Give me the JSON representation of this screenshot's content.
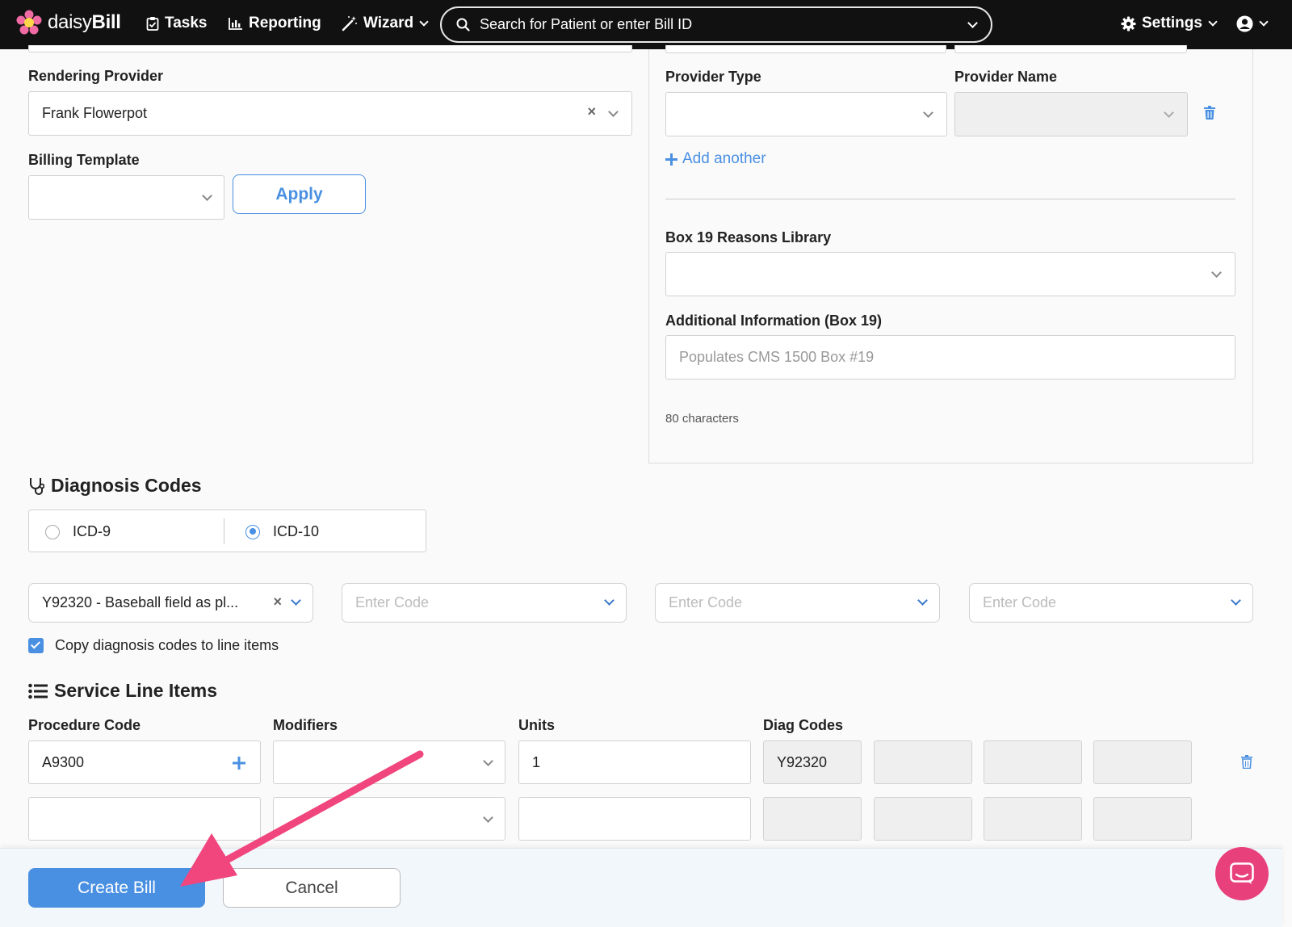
{
  "nav": {
    "logo_prefix": "daisy",
    "logo_suffix": "Bill",
    "tasks": "Tasks",
    "reporting": "Reporting",
    "wizard": "Wizard",
    "search_placeholder": "Search for Patient or enter Bill ID",
    "settings": "Settings"
  },
  "left_form": {
    "rendering_provider_label": "Rendering Provider",
    "rendering_provider_value": "Frank Flowerpot",
    "billing_template_label": "Billing Template",
    "apply_label": "Apply"
  },
  "right_form": {
    "provider_type_label": "Provider Type",
    "provider_name_label": "Provider Name",
    "add_another_label": "Add another",
    "box19_library_label": "Box 19 Reasons Library",
    "additional_info_label": "Additional Information (Box 19)",
    "additional_info_placeholder": "Populates CMS 1500 Box #19",
    "char_count": "80 characters"
  },
  "diagnosis": {
    "title": "Diagnosis Codes",
    "icd9_label": "ICD-9",
    "icd10_label": "ICD-10",
    "selected": "ICD-10",
    "code1_value": "Y92320 - Baseball field as pl...",
    "code_placeholder": "Enter Code",
    "copy_label": "Copy diagnosis codes to line items",
    "copy_checked": true
  },
  "service_lines": {
    "title": "Service Line Items",
    "headers": {
      "procedure": "Procedure Code",
      "modifiers": "Modifiers",
      "units": "Units",
      "diag": "Diag Codes"
    },
    "rows": [
      {
        "procedure": "A9300",
        "units": "1",
        "diag1": "Y92320"
      },
      {
        "procedure": "",
        "units": "",
        "diag1": ""
      }
    ]
  },
  "footer": {
    "create_label": "Create Bill",
    "cancel_label": "Cancel"
  },
  "colors": {
    "accent": "#4a90e2",
    "annotation_arrow": "#f0457d",
    "chat_button": "#e8407a",
    "nav_bg": "#111111"
  }
}
